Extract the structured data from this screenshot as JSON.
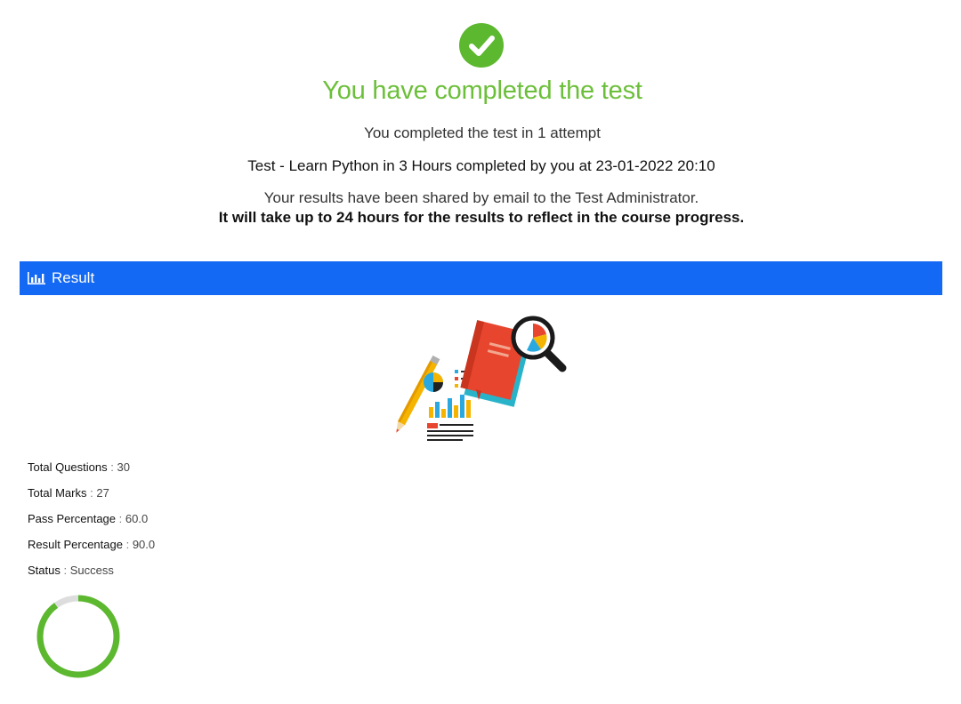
{
  "header": {
    "status_icon": "check-circle-icon",
    "headline": "You have completed the test",
    "attempt_text": "You completed the test in 1 attempt",
    "test_summary": "Test - Learn Python in 3 Hours completed by you at 23-01-2022 20:10",
    "email_note": "Your results have been shared by email to the Test Administrator.",
    "progress_note": "It will take up to 24 hours for the results to reflect in the course progress."
  },
  "result_section": {
    "icon": "bar-chart-icon",
    "title": "Result"
  },
  "stats": [
    {
      "label": "Total Questions",
      "separator": ":",
      "value": "30"
    },
    {
      "label": "Total Marks",
      "separator": ":",
      "value": "27"
    },
    {
      "label": "Pass Percentage",
      "separator": ":",
      "value": "60.0"
    },
    {
      "label": "Result Percentage",
      "separator": ":",
      "value": "90.0"
    },
    {
      "label": "Status",
      "separator": ":",
      "value": "Success"
    }
  ],
  "score_ring": {
    "percentage": 90.0
  },
  "colors": {
    "success_green": "#6cbf3a",
    "header_blue": "#1369f4"
  }
}
